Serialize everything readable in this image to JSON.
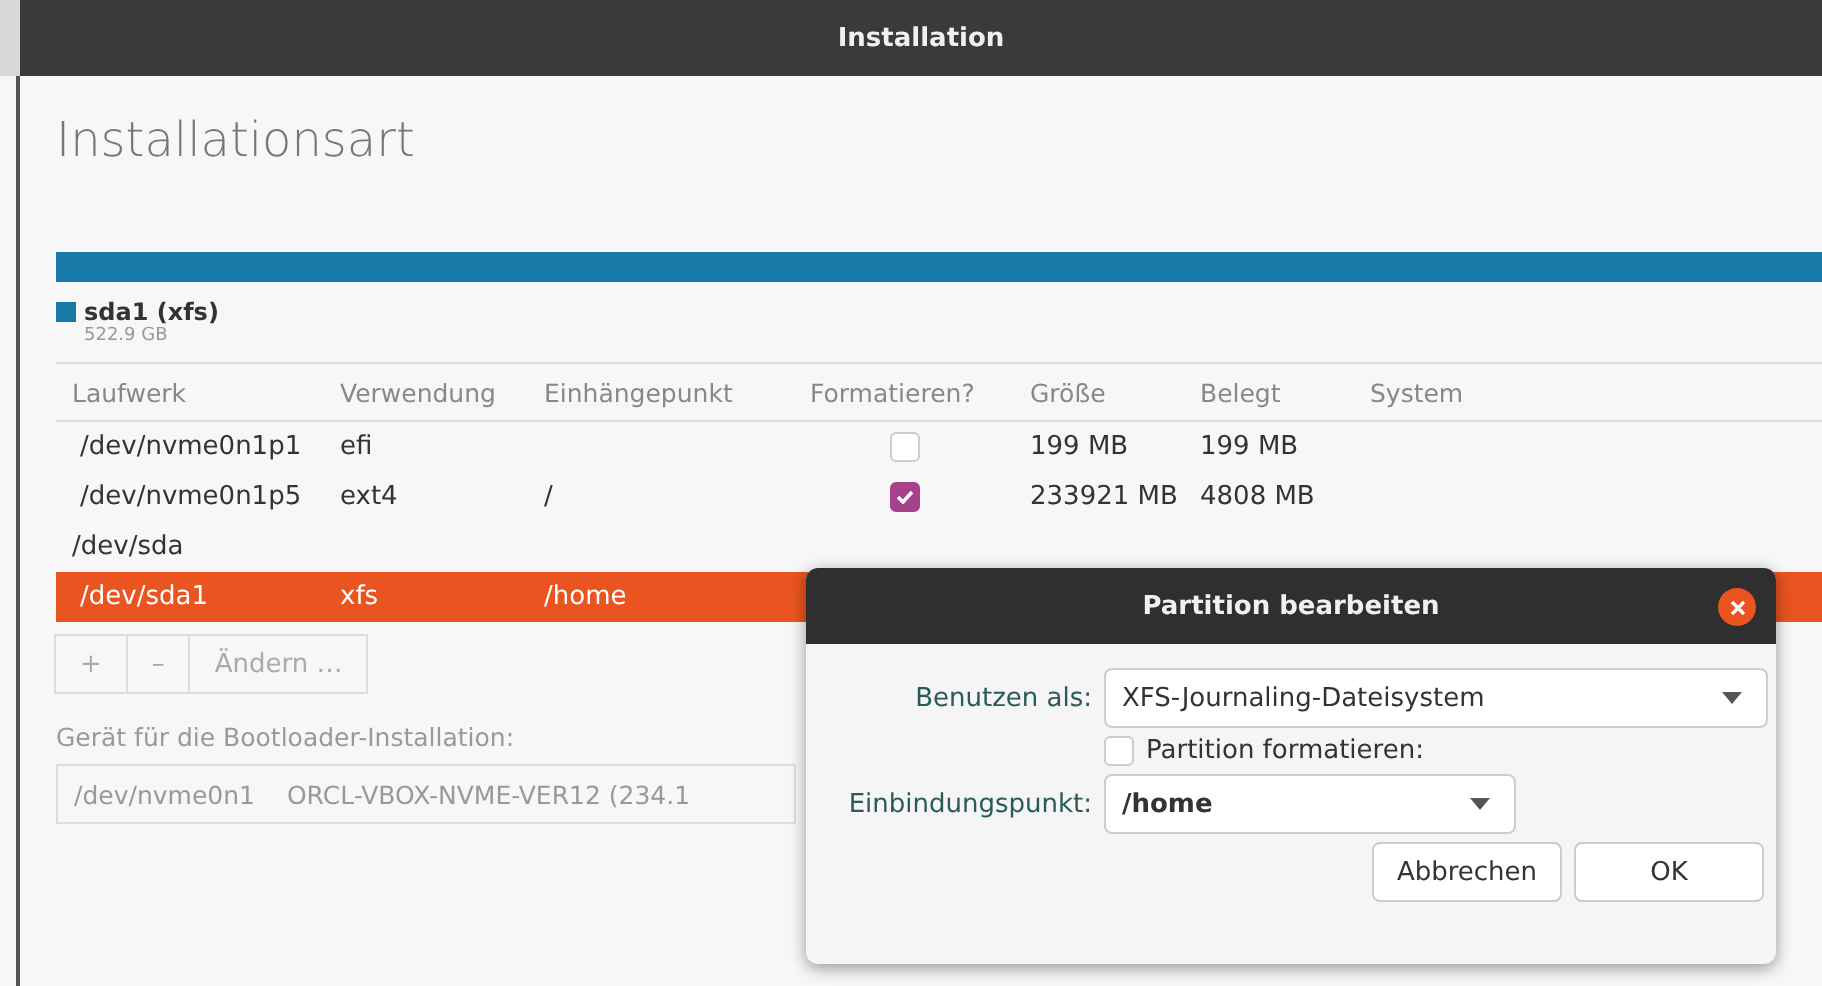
{
  "window": {
    "title": "Installation"
  },
  "page_title": "Installationsart",
  "partition_bar": {
    "segments": [
      {
        "label": "sda1 (xfs)",
        "size": "522.9 GB",
        "color": "#1779a8"
      }
    ]
  },
  "table": {
    "columns": [
      "Laufwerk",
      "Verwendung",
      "Einhängepunkt",
      "Formatieren?",
      "Größe",
      "Belegt",
      "System"
    ],
    "rows": [
      {
        "kind": "partition",
        "device": "/dev/nvme0n1p1",
        "usage": "efi",
        "mount": "",
        "format_checked": false,
        "size": "199 MB",
        "used": "199 MB",
        "selected": false
      },
      {
        "kind": "partition",
        "device": "/dev/nvme0n1p5",
        "usage": "ext4",
        "mount": "/",
        "format_checked": true,
        "size": "233921 MB",
        "used": "4808 MB",
        "selected": false
      },
      {
        "kind": "disk",
        "device": "/dev/sda",
        "selected": false
      },
      {
        "kind": "partition",
        "device": "/dev/sda1",
        "usage": "xfs",
        "mount": "/home",
        "selected": true
      }
    ]
  },
  "table_buttons": [
    {
      "label": "+",
      "disabled": true
    },
    {
      "label": "–",
      "disabled": true
    },
    {
      "label": "Ändern …",
      "disabled": true
    }
  ],
  "bootloader": {
    "label": "Gerät für die Bootloader-Installation:",
    "device": "/dev/nvme0n1",
    "model": "ORCL-VBOX-NVME-VER12 (234.1"
  },
  "dialog": {
    "title": "Partition bearbeiten",
    "use_as_label": "Benutzen als:",
    "use_as_value": "XFS-Journaling-Dateisystem",
    "format_label": "Partition formatieren:",
    "format_checked": false,
    "mount_label": "Einbindungspunkt:",
    "mount_value": "/home",
    "buttons": [
      "Abbrechen",
      "OK"
    ]
  }
}
